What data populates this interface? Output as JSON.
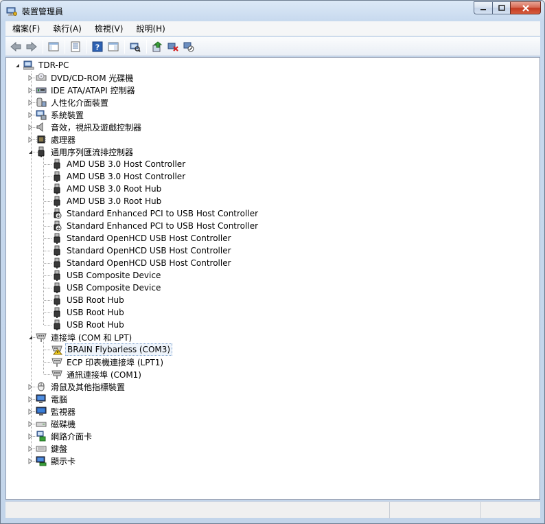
{
  "window": {
    "title": "裝置管理員"
  },
  "menu": [
    "檔案(F)",
    "執行(A)",
    "檢視(V)",
    "說明(H)"
  ],
  "toolbar": {
    "icons": [
      "back-arrow-icon",
      "forward-arrow-icon",
      "view-tree-icon",
      "properties-icon",
      "help-icon",
      "console-tree-icon",
      "scan-hardware-icon",
      "update-driver-icon",
      "uninstall-icon",
      "disable-device-icon"
    ]
  },
  "tree": {
    "root": "TDR-PC",
    "categories": [
      {
        "label": "DVD/CD-ROM 光碟機",
        "icon": "dvd-drive-icon"
      },
      {
        "label": "IDE ATA/ATAPI 控制器",
        "icon": "ide-controller-icon"
      },
      {
        "label": "人性化介面裝置",
        "icon": "hid-icon"
      },
      {
        "label": "系統裝置",
        "icon": "system-device-icon"
      },
      {
        "label": "音效，視訊及遊戲控制器",
        "icon": "speaker-icon"
      },
      {
        "label": "處理器",
        "icon": "processor-icon"
      },
      {
        "label": "通用序列匯流排控制器",
        "icon": "usb-icon",
        "expanded": true
      },
      {
        "label": "連接埠 (COM 和 LPT)",
        "icon": "port-icon",
        "expanded": true
      },
      {
        "label": "滑鼠及其他指標裝置",
        "icon": "mouse-icon"
      },
      {
        "label": "電腦",
        "icon": "computer-icon"
      },
      {
        "label": "監視器",
        "icon": "monitor-icon"
      },
      {
        "label": "磁碟機",
        "icon": "disk-drive-icon"
      },
      {
        "label": "網路介面卡",
        "icon": "network-adapter-icon"
      },
      {
        "label": "鍵盤",
        "icon": "keyboard-icon"
      },
      {
        "label": "顯示卡",
        "icon": "display-adapter-icon"
      }
    ],
    "usb_children": [
      {
        "label": "AMD USB 3.0 Host Controller",
        "icon": "usb-plug-icon"
      },
      {
        "label": "AMD USB 3.0 Host Controller",
        "icon": "usb-plug-icon"
      },
      {
        "label": "AMD USB 3.0 Root Hub",
        "icon": "usb-plug-icon"
      },
      {
        "label": "AMD USB 3.0 Root Hub",
        "icon": "usb-plug-icon"
      },
      {
        "label": "Standard Enhanced PCI to USB Host Controller",
        "icon": "usb-disabled-icon"
      },
      {
        "label": "Standard Enhanced PCI to USB Host Controller",
        "icon": "usb-disabled-icon"
      },
      {
        "label": "Standard OpenHCD USB Host Controller",
        "icon": "usb-plug-icon"
      },
      {
        "label": "Standard OpenHCD USB Host Controller",
        "icon": "usb-plug-icon"
      },
      {
        "label": "Standard OpenHCD USB Host Controller",
        "icon": "usb-plug-icon"
      },
      {
        "label": "USB Composite Device",
        "icon": "usb-plug-icon"
      },
      {
        "label": "USB Composite Device",
        "icon": "usb-plug-icon"
      },
      {
        "label": "USB Root Hub",
        "icon": "usb-plug-icon"
      },
      {
        "label": "USB Root Hub",
        "icon": "usb-plug-icon"
      },
      {
        "label": "USB Root Hub",
        "icon": "usb-plug-icon"
      }
    ],
    "port_children": [
      {
        "label": "BRAIN Flybarless (COM3)",
        "icon": "port-warning-icon",
        "selected": true
      },
      {
        "label": "ECP 印表機連接埠 (LPT1)",
        "icon": "port-icon"
      },
      {
        "label": "通訊連接埠 (COM1)",
        "icon": "port-icon"
      }
    ]
  }
}
